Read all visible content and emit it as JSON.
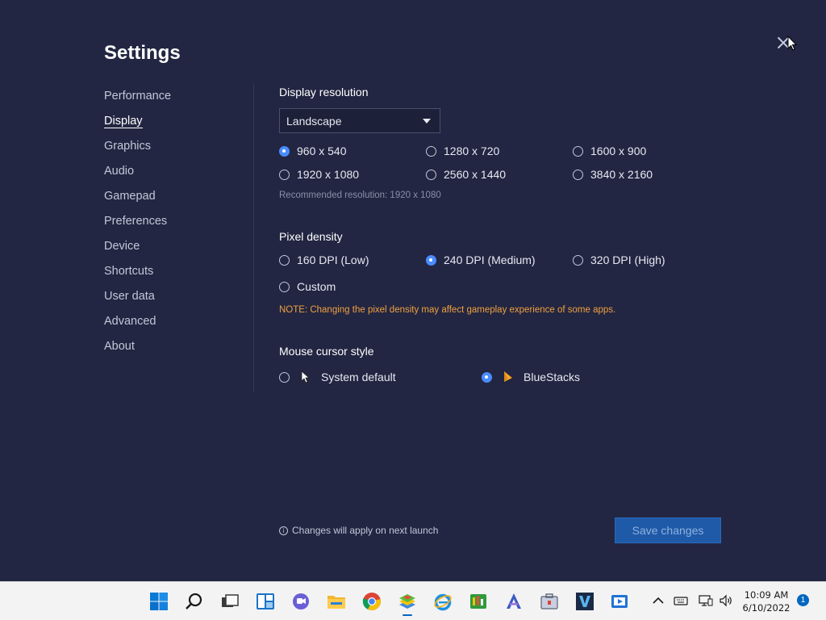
{
  "settings": {
    "title": "Settings",
    "nav": [
      "Performance",
      "Display",
      "Graphics",
      "Audio",
      "Gamepad",
      "Preferences",
      "Device",
      "Shortcuts",
      "User data",
      "Advanced",
      "About"
    ],
    "active_nav": "Display"
  },
  "display_resolution": {
    "label": "Display resolution",
    "orientation": "Landscape",
    "options": [
      "960 x 540",
      "1280 x 720",
      "1600 x 900",
      "1920 x 1080",
      "2560 x 1440",
      "3840 x 2160"
    ],
    "selected": "960 x 540",
    "recommended": "Recommended resolution: 1920 x 1080"
  },
  "pixel_density": {
    "label": "Pixel density",
    "options": [
      "160 DPI (Low)",
      "240 DPI (Medium)",
      "320 DPI (High)",
      "Custom"
    ],
    "selected": "240 DPI (Medium)",
    "note": "NOTE: Changing the pixel density may affect gameplay experience of some apps."
  },
  "mouse_cursor": {
    "label": "Mouse cursor style",
    "options": [
      "System default",
      "BlueStacks"
    ],
    "selected": "BlueStacks"
  },
  "footer": {
    "info": "Changes will apply on next launch",
    "save_label": "Save changes"
  },
  "taskbar": {
    "time": "10:09 AM",
    "date": "6/10/2022",
    "notification_count": "1"
  },
  "colors": {
    "background": "#222642",
    "accent": "#4a8cff",
    "note": "#f0a040",
    "save_button": "#1e5aa8"
  }
}
